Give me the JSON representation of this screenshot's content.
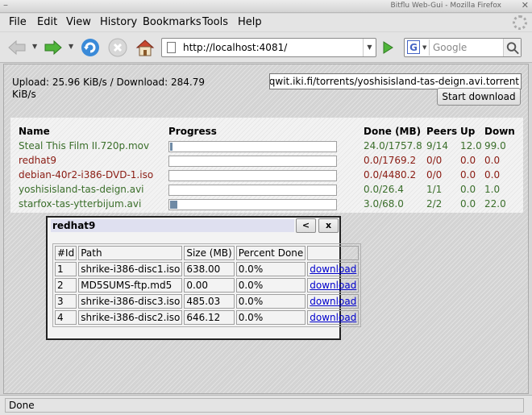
{
  "window": {
    "title": "Bitflu Web-Gui - Mozilla Firefox",
    "close_glyph": "✕"
  },
  "menu": [
    {
      "label": "File"
    },
    {
      "label": "Edit"
    },
    {
      "label": "View"
    },
    {
      "label": "History"
    },
    {
      "label": "Bookmarks"
    },
    {
      "label": "Tools"
    },
    {
      "label": "Help"
    }
  ],
  "toolbar": {
    "url": "http://localhost:4081/",
    "search_placeholder": "Google",
    "engine_letter": "G"
  },
  "page": {
    "speed_text": "Upload: 25.96 KiB/s / Download: 284.79 KiB/s",
    "torrent_input": "http://bisqwit.iki.fi/torrents/yoshisisland-tas-deign.avi.torrent",
    "start_button": "Start download",
    "headers": {
      "name": "Name",
      "progress": "Progress",
      "done": "Done (MB)",
      "peers": "Peers",
      "up": "Up",
      "down": "Down"
    },
    "torrents": [
      {
        "name": "Steal This Film II.720p.mov",
        "progress": 0.014,
        "done": "24.0/1757.8",
        "peers": "9/14",
        "up": "12.0",
        "down": "99.0",
        "status": "green"
      },
      {
        "name": "redhat9",
        "progress": 0.0,
        "done": "0.0/1769.2",
        "peers": "0/0",
        "up": "0.0",
        "down": "0.0",
        "status": "red"
      },
      {
        "name": "debian-40r2-i386-DVD-1.iso",
        "progress": 0.0,
        "done": "0.0/4480.2",
        "peers": "0/0",
        "up": "0.0",
        "down": "0.0",
        "status": "red"
      },
      {
        "name": "yoshisisland-tas-deign.avi",
        "progress": 0.0,
        "done": "0.0/26.4",
        "peers": "1/1",
        "up": "0.0",
        "down": "1.0",
        "status": "green"
      },
      {
        "name": "starfox-tas-ytterbijum.avi",
        "progress": 0.044,
        "done": "3.0/68.0",
        "peers": "2/2",
        "up": "0.0",
        "down": "22.0",
        "status": "green"
      }
    ]
  },
  "popup": {
    "title": "redhat9",
    "prev_button": "<",
    "close_button": "x",
    "headers": {
      "id": "#Id",
      "path": "Path",
      "size": "Size (MB)",
      "percent": "Percent Done"
    },
    "files": [
      {
        "id": "1",
        "path": "shrike-i386-disc1.iso",
        "size": "638.00",
        "percent": "0.0%",
        "link": "download"
      },
      {
        "id": "2",
        "path": "MD5SUMS-ftp.md5",
        "size": "0.00",
        "percent": "0.0%",
        "link": "download"
      },
      {
        "id": "3",
        "path": "shrike-i386-disc3.iso",
        "size": "485.03",
        "percent": "0.0%",
        "link": "download"
      },
      {
        "id": "4",
        "path": "shrike-i386-disc2.iso",
        "size": "646.12",
        "percent": "0.0%",
        "link": "download"
      }
    ]
  },
  "statusbar": {
    "text": "Done"
  },
  "colors": {
    "green_text": "#3a6e2a",
    "red_text": "#8a1b12",
    "progress_fill": "#6f8aa5",
    "link": "#0000cc"
  }
}
